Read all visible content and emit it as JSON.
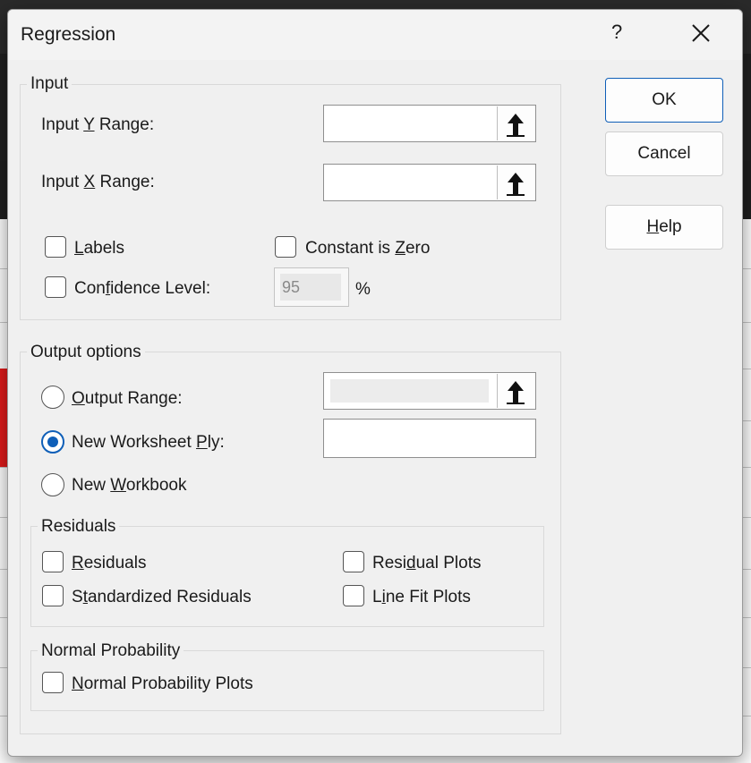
{
  "dialog": {
    "title": "Regression",
    "help_glyph": "?",
    "buttons": {
      "ok": "OK",
      "cancel": "Cancel",
      "help": "Help"
    }
  },
  "input": {
    "legend": "Input",
    "y_range": {
      "pre": "Input ",
      "key": "Y",
      "post": " Range:",
      "value": ""
    },
    "x_range": {
      "pre": "Input ",
      "key": "X",
      "post": " Range:",
      "value": ""
    },
    "labels": {
      "key": "L",
      "post": "abels",
      "checked": false
    },
    "constant_zero": {
      "pre": "Constant is ",
      "key": "Z",
      "post": "ero",
      "checked": false
    },
    "confidence": {
      "pre": "Con",
      "key": "f",
      "post": "idence Level:",
      "value": "95",
      "unit": "%",
      "checked": false
    }
  },
  "output": {
    "legend": "Output options",
    "output_range": {
      "key": "O",
      "post": "utput Range:",
      "selected": false
    },
    "new_ply": {
      "pre": "New Worksheet ",
      "key": "P",
      "post": "ly:",
      "selected": true
    },
    "new_workbook": {
      "pre": "New ",
      "key": "W",
      "post": "orkbook",
      "selected": false
    }
  },
  "residuals": {
    "legend": "Residuals",
    "residuals": {
      "key": "R",
      "post": "esiduals"
    },
    "standardized": {
      "pre": "S",
      "key": "t",
      "post": "andardized Residuals"
    },
    "residual_plots": {
      "pre": "Resi",
      "key": "d",
      "post": "ual Plots"
    },
    "line_fit": {
      "pre": "L",
      "key": "i",
      "post": "ne Fit Plots"
    }
  },
  "normal": {
    "legend": "Normal Probability",
    "plots": {
      "key": "N",
      "post": "ormal Probability Plots"
    }
  },
  "colors": {
    "accent": "#0f5fb8"
  },
  "icons": {
    "range_picker": "up-arrow-icon",
    "close": "close-icon"
  }
}
